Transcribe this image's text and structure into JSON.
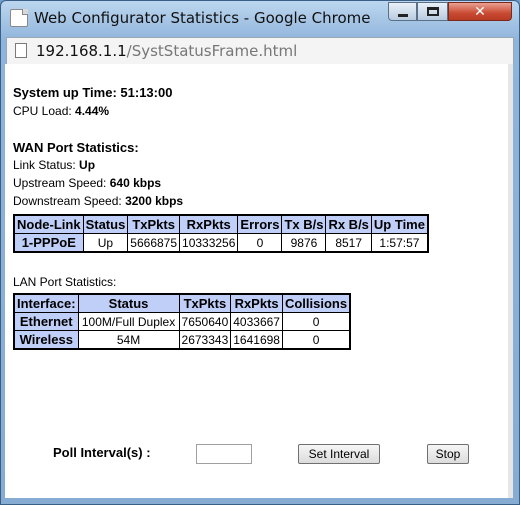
{
  "window": {
    "title": "Web Configurator Statistics - Google Chrome",
    "close_glyph": "✕"
  },
  "address": {
    "host": "192.168.1.1",
    "path": "/SystStatusFrame.html"
  },
  "system": {
    "uptime_label": "System up Time: ",
    "uptime_value": "51:13:00",
    "cpu_label": "CPU Load: ",
    "cpu_value": "4.44%"
  },
  "wan": {
    "heading": "WAN Port Statistics:",
    "link_status_label": "Link Status: ",
    "link_status_value": "Up",
    "upstream_label": "Upstream Speed: ",
    "upstream_value": "640 kbps",
    "downstream_label": "Downstream Speed: ",
    "downstream_value": "3200 kbps",
    "columns": [
      "Node-Link",
      "Status",
      "TxPkts",
      "RxPkts",
      "Errors",
      "Tx B/s",
      "Rx B/s",
      "Up Time"
    ],
    "rows": [
      [
        "1-PPPoE",
        "Up",
        "5666875",
        "10333256",
        "0",
        "9876",
        "8517",
        "1:57:57"
      ]
    ]
  },
  "lan": {
    "heading": "LAN Port Statistics:",
    "columns": [
      "Interface:",
      "Status",
      "TxPkts",
      "RxPkts",
      "Collisions"
    ],
    "rows": [
      [
        "Ethernet",
        "100M/Full Duplex",
        "7650640",
        "4033667",
        "0"
      ],
      [
        "Wireless",
        "54M",
        "2673343",
        "1641698",
        "0"
      ]
    ]
  },
  "poll": {
    "label": "Poll Interval(s) :",
    "value": "",
    "set_button": "Set Interval",
    "stop_button": "Stop"
  }
}
